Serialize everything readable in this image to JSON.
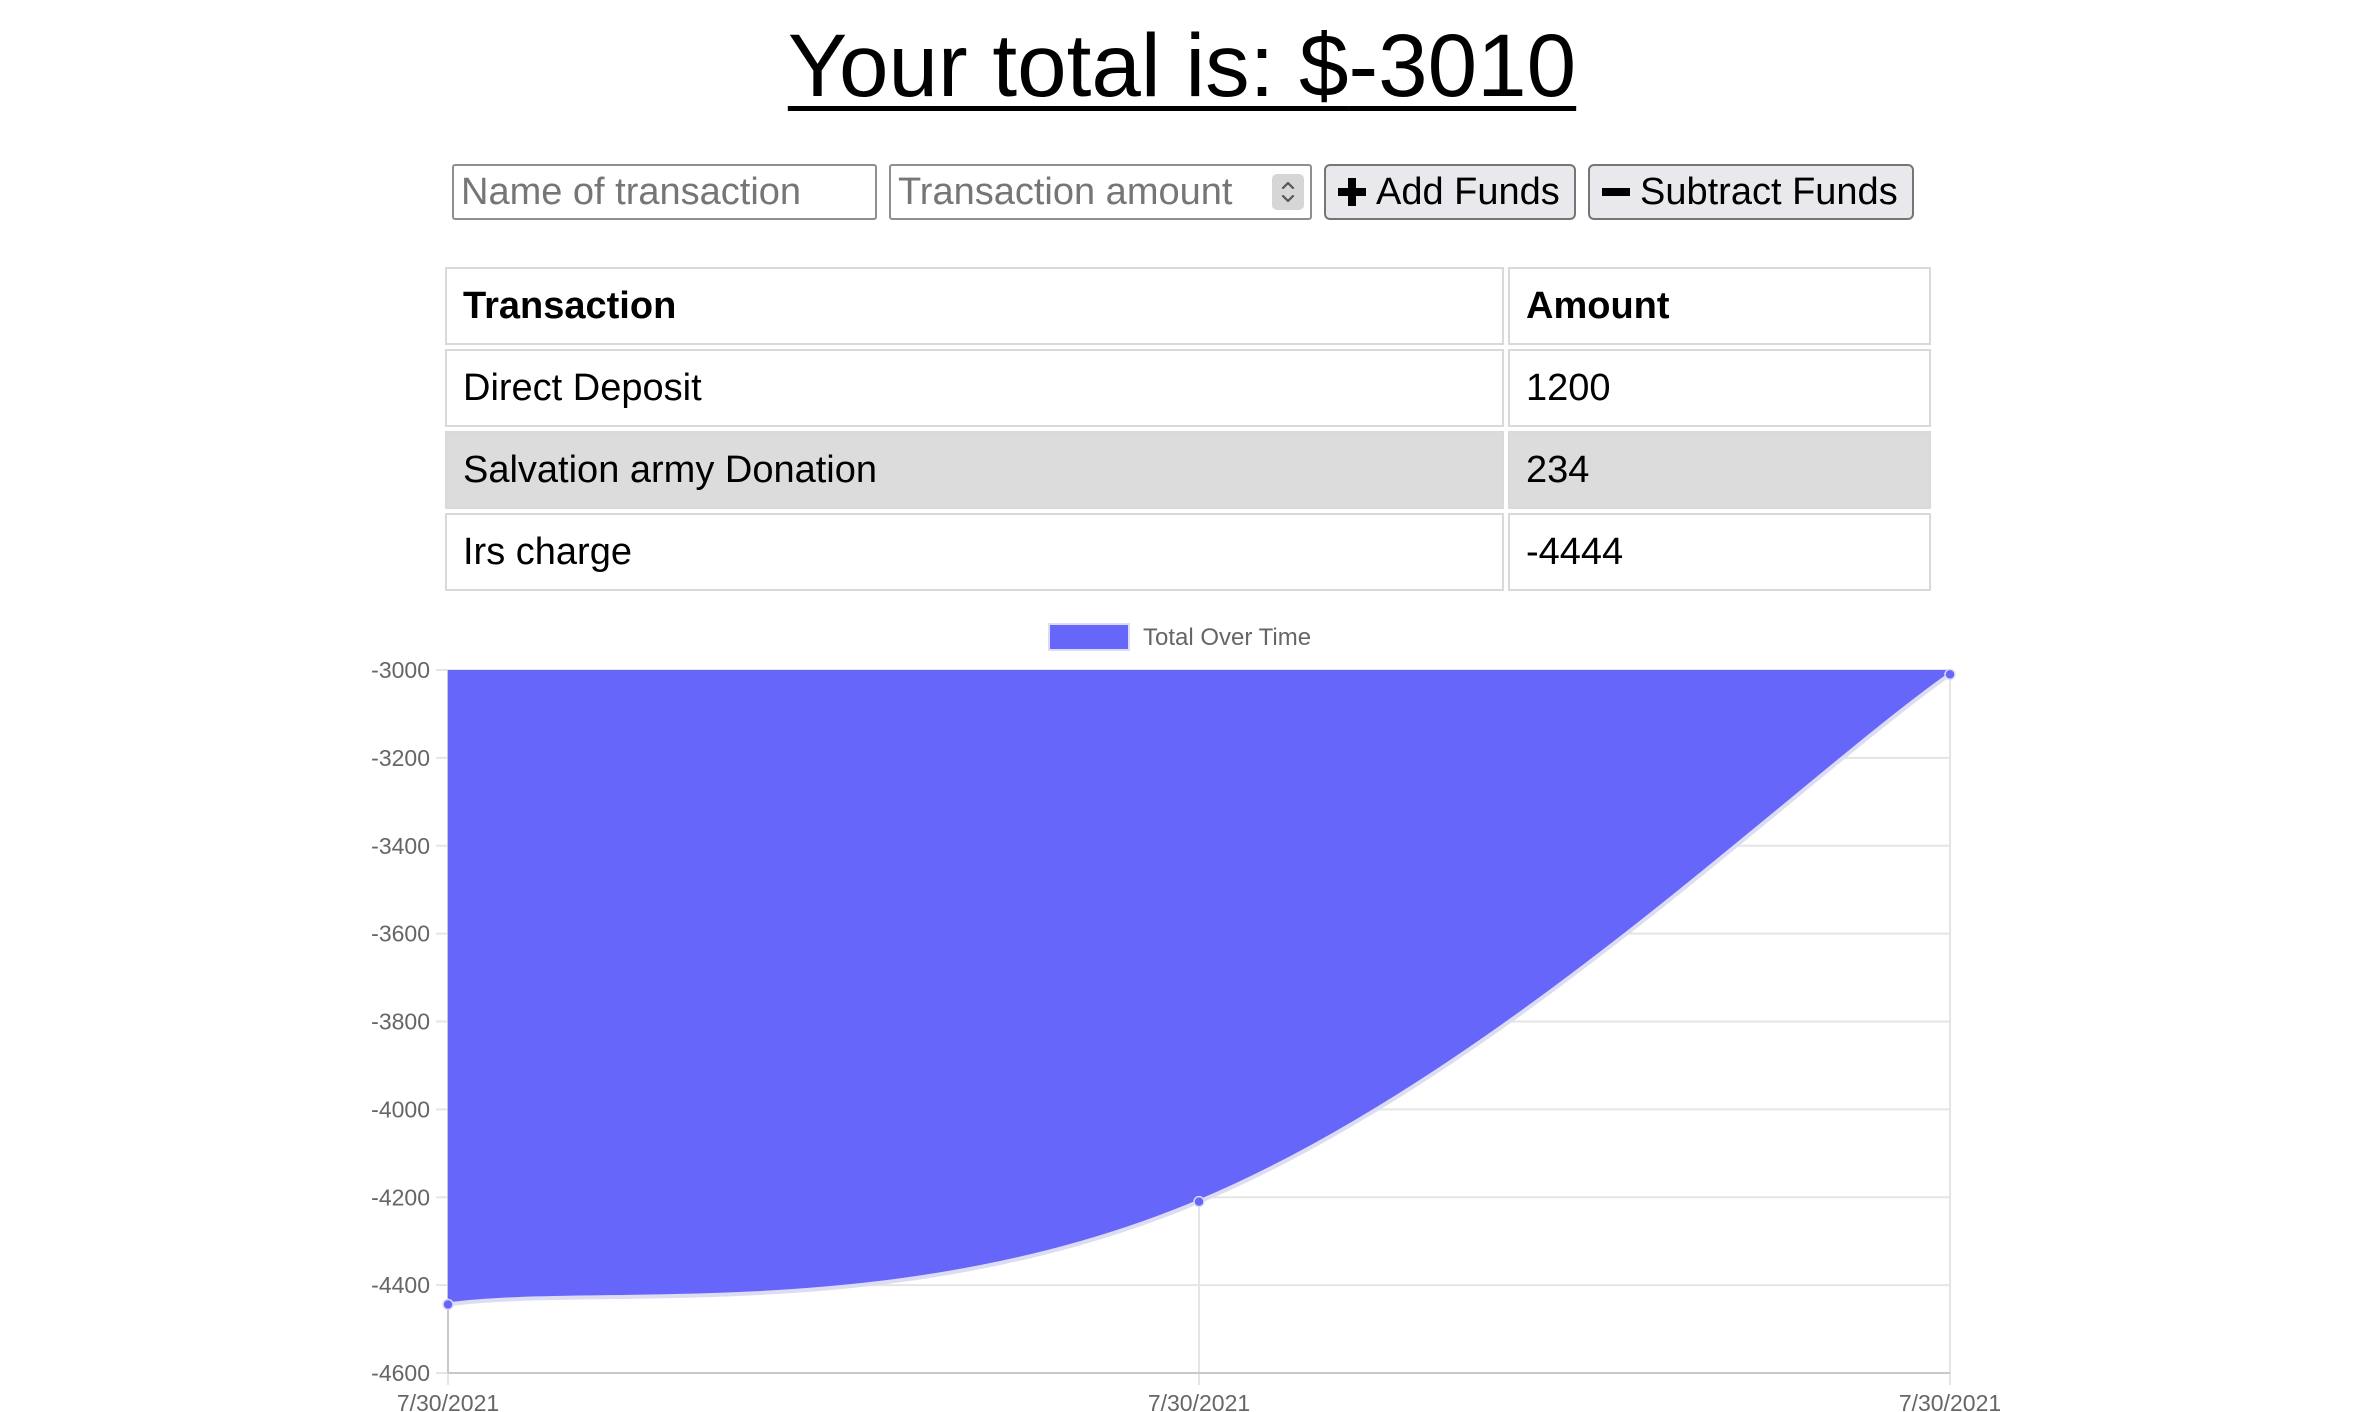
{
  "header": {
    "prefix": "Your total is: $",
    "total": "-3010"
  },
  "form": {
    "name_placeholder": "Name of transaction",
    "amount_placeholder": "Transaction amount",
    "add_label": "Add Funds",
    "subtract_label": "Subtract Funds"
  },
  "table": {
    "headers": [
      "Transaction",
      "Amount"
    ],
    "rows": [
      {
        "name": "Direct Deposit",
        "amount": "1200"
      },
      {
        "name": "Salvation army Donation",
        "amount": "234"
      },
      {
        "name": "Irs charge",
        "amount": "-4444"
      }
    ]
  },
  "chart_data": {
    "type": "area",
    "x": [
      "7/30/2021",
      "7/30/2021",
      "7/30/2021"
    ],
    "series": [
      {
        "name": "Total Over Time",
        "values": [
          -4444,
          -4210,
          -3010
        ]
      }
    ],
    "yticks": [
      -3000,
      -3200,
      -3400,
      -3600,
      -3800,
      -4000,
      -4200,
      -4400,
      -4600
    ],
    "ylim": [
      -4600,
      -3000
    ],
    "legend": "top-center",
    "grid": true,
    "fill_color": "#6666fa",
    "line_color": "#dcdcf2",
    "point_color": "#6666fa"
  }
}
